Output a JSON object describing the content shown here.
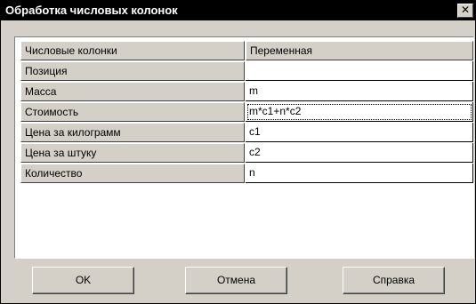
{
  "window": {
    "title": "Обработка числовых колонок",
    "close_glyph": "✕"
  },
  "grid": {
    "headers": [
      "Числовые колонки",
      "Переменная"
    ],
    "rows": [
      {
        "name": "Позиция",
        "value": ""
      },
      {
        "name": "Масса",
        "value": "m"
      },
      {
        "name": "Стоимость",
        "value": "m*c1+n*c2"
      },
      {
        "name": "Цена за килограмм",
        "value": "c1"
      },
      {
        "name": "Цена за штуку",
        "value": "c2"
      },
      {
        "name": "Количество",
        "value": "n"
      }
    ]
  },
  "buttons": {
    "ok": "OK",
    "cancel": "Отмена",
    "help": "Справка"
  }
}
